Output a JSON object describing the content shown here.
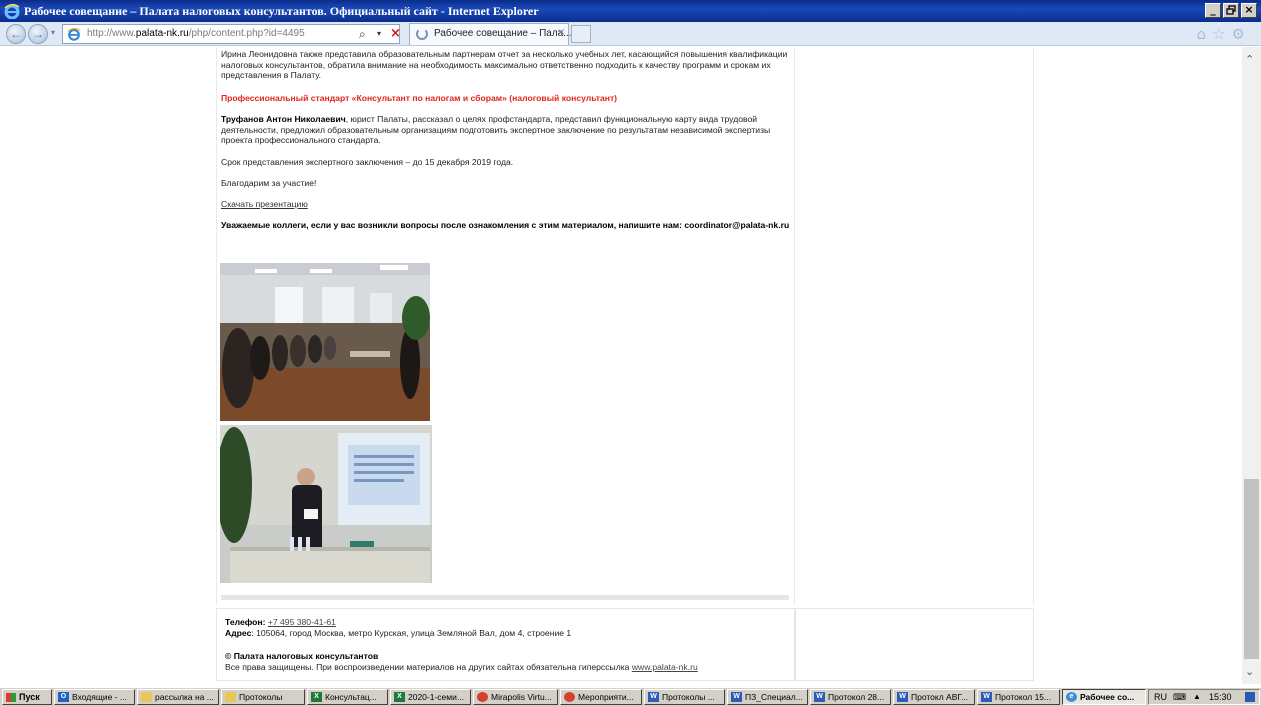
{
  "window": {
    "title": "Рабочее совещание – Палата налоговых консультантов. Официальный сайт - Internet Explorer",
    "min_glyph": "_",
    "max_glyph": "🗗",
    "close_glyph": "×"
  },
  "navbar": {
    "url_prefix": "http://www.",
    "url_domain": "palata-nk.ru",
    "url_path": "/php/content.php?id=4495",
    "tab_label": "Рабочее совещание – Пала...",
    "tab_close": "×",
    "search_glyph": "⌕",
    "dropdown_glyph": "▾",
    "stop_glyph": "×",
    "home_glyph": "⌂",
    "favorites_glyph": "☆",
    "tools_glyph": "⚙",
    "back_glyph": "←",
    "forward_glyph": "→"
  },
  "article": {
    "intro": "Ирина Леонидовна также представила образовательным партнерам отчет за несколько учебных лет, касающийся повышения квалификации налоговых консультантов, обратила внимание на необходимость максимально ответственно подходить к качеству программ и срокам их представления в Палату.",
    "standard_heading": "Профессиональный стандарт «Консультант по налогам и сборам» (налоговый консультант)",
    "trufanov_name": "Труфанов Антон Николаевич",
    "trufanov_text": ", юрист Палаты, рассказал о целях профстандарта, представил функциональную карту вида трудовой деятельности, предложил образовательным организациям подготовить экспертное заключение по результатам независимой экспертизы проекта профессионального стандарта.",
    "deadline": "Срок представления экспертного заключения – до 15 декабря 2019 года.",
    "thanks": "Благодарим за участие!",
    "download_link": "Скачать презентацию",
    "contact_note": "Уважаемые коллеги, если у вас возникли вопросы после ознакомления с этим материалом, напишите нам: coordinator@palata-nk.ru"
  },
  "footer": {
    "phone_label": "Телефон:",
    "phone": "+7 495 380-41-61",
    "address_label": "Адрес",
    "address": ": 105064, город Москва, метро Курская, улица Земляной Вал, дом 4, строение 1",
    "copyright": "© Палата налоговых консультантов",
    "rights": "Все права защищены. При воспроизведении материалов на других сайтах обязательна гиперссылка ",
    "rights_link": "www.palata-nk.ru"
  },
  "scrollbar": {
    "up_glyph": "⌃",
    "down_glyph": "⌄",
    "position": 0.7
  },
  "taskbar": {
    "start_label": "Пуск",
    "tasks": [
      {
        "label": "Входящие - ...",
        "icon": "outlook-icon",
        "color": "#1f63c6",
        "glyph": "O"
      },
      {
        "label": "рассылка на ...",
        "icon": "folder-icon",
        "color": "#e9c65a",
        "glyph": ""
      },
      {
        "label": "Протоколы",
        "icon": "folder-icon",
        "color": "#e9c65a",
        "glyph": ""
      },
      {
        "label": "Консультац...",
        "icon": "excel-icon",
        "color": "#1f7a3a",
        "glyph": "X"
      },
      {
        "label": "2020-1-семи...",
        "icon": "excel-icon",
        "color": "#1f7a3a",
        "glyph": "X"
      },
      {
        "label": "Mirapolis Virtu...",
        "icon": "chrome-icon",
        "color": "#d6402f",
        "glyph": ""
      },
      {
        "label": "Мероприяти...",
        "icon": "chrome-icon",
        "color": "#d6402f",
        "glyph": ""
      },
      {
        "label": "Протоколы ...",
        "icon": "word-icon",
        "color": "#2b5cb8",
        "glyph": "W"
      },
      {
        "label": "ПЗ_Специал...",
        "icon": "word-icon",
        "color": "#2b5cb8",
        "glyph": "W"
      },
      {
        "label": "Протокол 28...",
        "icon": "word-icon",
        "color": "#2b5cb8",
        "glyph": "W"
      },
      {
        "label": "Протокл АВГ...",
        "icon": "word-icon",
        "color": "#2b5cb8",
        "glyph": "W"
      },
      {
        "label": "Протокол 15...",
        "icon": "word-icon",
        "color": "#2b5cb8",
        "glyph": "W"
      },
      {
        "label": "Рабочее со...",
        "icon": "ie-icon",
        "color": "#3f8fd8",
        "glyph": "e",
        "active": true
      }
    ],
    "lang": "RU",
    "tray_glyph": "⌨",
    "tray_arrow": "▲",
    "clock": "15:30"
  },
  "colors": {
    "titlebar": "#0a2d8c",
    "heading_red": "#e3251b",
    "taskbar": "#d4d0c8"
  }
}
